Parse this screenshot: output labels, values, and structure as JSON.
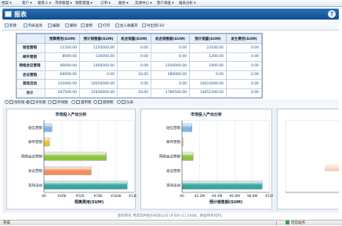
{
  "menu": [
    "档案 ▾",
    "客户 ▾",
    "联系人 ▾",
    "市场管理 ▾",
    "销售管理 ▾",
    "订单 ▾",
    "服务 ▾",
    "资源中心 ▾",
    "客户调查 ▾",
    "报表分析 ▾"
  ],
  "title": "报表",
  "help_label": "?",
  "toolbar": [
    "新建",
    "列表查询",
    "编辑",
    "删除",
    "复制",
    "打印",
    "加入收藏夹",
    "导出到CSV"
  ],
  "table": {
    "headers": [
      "",
      "预算费用(SUM)",
      "预计销售额(SUM)",
      "机会销量(SUM)",
      "机会销售额(SUM)",
      "预计销量(SUM)",
      "发生费用(SUM)"
    ],
    "rows": [
      [
        "短信营销",
        "11500.00",
        "1250000.00",
        "0.00",
        "0.00",
        "23100.00",
        "0.00"
      ],
      [
        "邮件营销",
        "8000.00",
        "130000.00",
        "0.00",
        "0.00",
        "1200.00",
        "0.00"
      ],
      [
        "网络会议营销",
        "90000.00",
        "1400000.00",
        "0.00",
        "1500000.00",
        "1000.00",
        "0.00"
      ],
      [
        "会议营销",
        "68000.00",
        "0.00",
        "18.00",
        "280000.00",
        "0.00",
        "0.00"
      ],
      [
        "现场活动",
        "120000.00",
        "10050000.00",
        "0.00",
        "0.00",
        "10015000.00",
        "0.00"
      ],
      [
        "合计",
        "297500.00",
        "12930000.00",
        "18.00",
        "1780500.00",
        "10051200.00",
        "0.00"
      ]
    ]
  },
  "chart_types": [
    {
      "label": "柱形图",
      "checked": false
    },
    {
      "label": "条形图",
      "checked": true
    },
    {
      "label": "折线图",
      "checked": false
    },
    {
      "label": "面积图",
      "checked": false
    },
    {
      "label": "圆饼图",
      "checked": false
    },
    {
      "label": "仪表",
      "checked": false
    }
  ],
  "chart_data": [
    {
      "type": "bar",
      "orientation": "horizontal",
      "title": "市场投入产出分析",
      "categories": [
        "短信营销",
        "邮件营销",
        "网络会议营销",
        "会议营销",
        "现场活动"
      ],
      "values": [
        11500,
        8000,
        90000,
        68000,
        120000
      ],
      "colors": [
        "#7fb6e6",
        "#f3c21b",
        "#8dc43f",
        "#f58f5a",
        "#3aa6a0"
      ],
      "xlabel": "预算费用(SUM)",
      "xlim": [
        0,
        130000
      ],
      "ticks": [
        "¥0",
        "¥26K",
        "¥52K",
        "¥78K",
        "¥104K",
        "¥130K"
      ]
    },
    {
      "type": "bar",
      "orientation": "horizontal",
      "title": "市场投入产出分析",
      "categories": [
        "短信营销",
        "邮件营销",
        "网络会议营销",
        "会议营销",
        "现场活动"
      ],
      "values": [
        1250000,
        130000,
        1400000,
        0,
        10050000
      ],
      "colors": [
        "#7fb6e6",
        "#f3c21b",
        "#8dc43f",
        "#f58f5a",
        "#3aa6a0"
      ],
      "xlabel": "预计销售额(SUM)",
      "xlim": [
        0,
        11000000
      ],
      "ticks": [
        "¥0",
        "¥2.2M",
        "¥4.4M",
        "¥6.6M",
        "¥8.8M",
        "¥11M"
      ]
    },
    {
      "type": "bar",
      "orientation": "horizontal",
      "title": "",
      "categories": [
        "",
        "",
        "",
        "",
        ""
      ],
      "values": [
        0,
        0,
        0,
        0,
        0
      ],
      "colors": [
        "#7fb6e6",
        "#f3c21b",
        "#8dc43f",
        "#f58f5a",
        "#3aa6a0"
      ],
      "xlabel": "",
      "xlim": [
        0,
        1
      ],
      "ticks": []
    }
  ],
  "footer": "版权所有 用友软件股份有限公司 UFIDA (C) 2008。保留所有权利。",
  "status": {
    "left": "完成",
    "zone": "可信站点"
  },
  "colors": {
    "title_bg": "#1b5ea3",
    "accent": "#2d6fb3"
  }
}
